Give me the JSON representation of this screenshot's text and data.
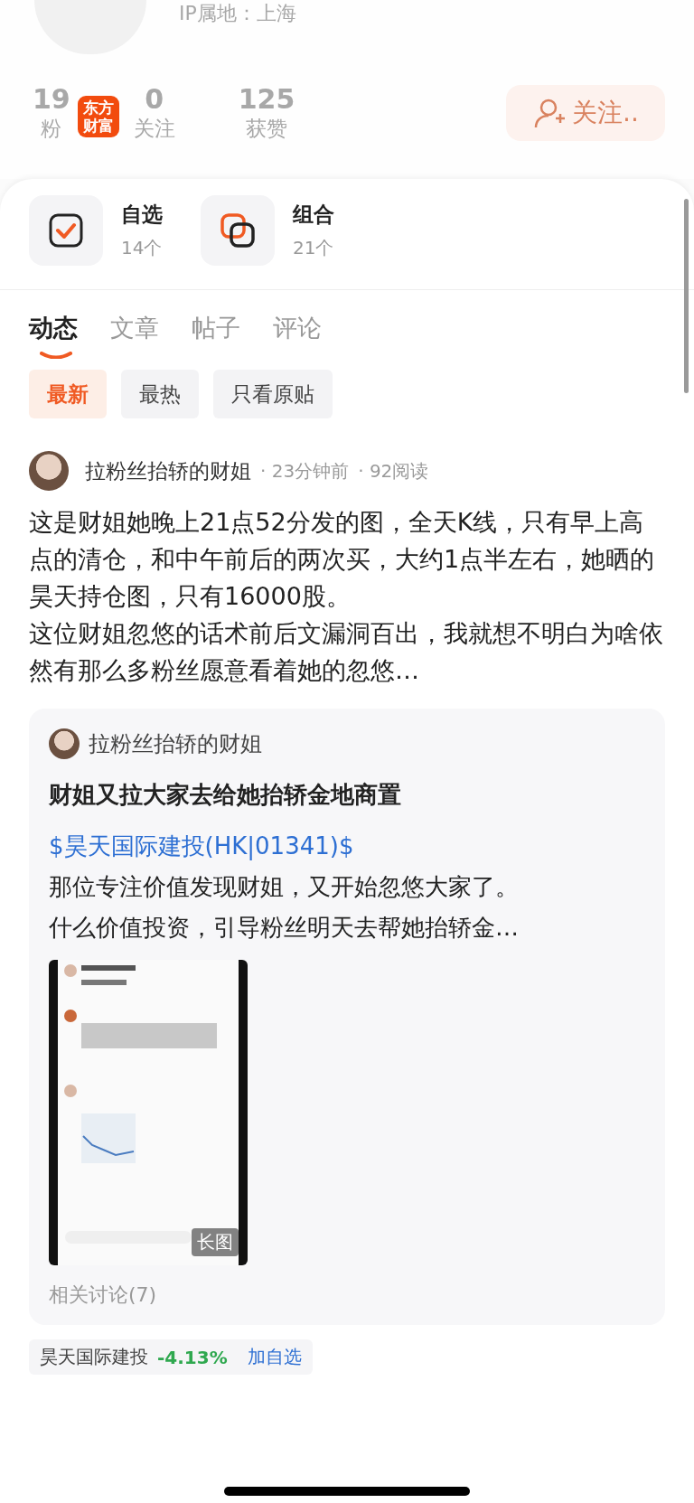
{
  "profile": {
    "ip_location": "IP属地：上海",
    "stats": [
      {
        "value": "19",
        "label": "粉"
      },
      {
        "value": "0",
        "label": "关注"
      },
      {
        "value": "125",
        "label": "获赞"
      }
    ],
    "follow_button": "关注..",
    "app_logo": "东方财富"
  },
  "shortcuts": [
    {
      "kind": "watchlist",
      "title": "自选",
      "count": "14个"
    },
    {
      "kind": "portfolio",
      "title": "组合",
      "count": "21个"
    }
  ],
  "tabs": [
    {
      "label": "动态",
      "selected": true
    },
    {
      "label": "文章",
      "selected": false
    },
    {
      "label": "帖子",
      "selected": false
    },
    {
      "label": "评论",
      "selected": false
    }
  ],
  "filters": [
    {
      "label": "最新",
      "selected": true
    },
    {
      "label": "最热",
      "selected": false
    },
    {
      "label": "只看原贴",
      "selected": false
    }
  ],
  "post": {
    "author": "拉粉丝抬轿的财姐",
    "time": "· 23分钟前",
    "reads": "· 92阅读",
    "paragraphs": [
      "这是财姐她晚上21点52分发的图，全天K线，只有早上高点的清仓，和中午前后的两次买，大约1点半左右，她晒的昊天持仓图，只有16000股。",
      "这位财姐忽悠的话术前后文漏洞百出，我就想不明白为啥依然有那么多粉丝愿意看着她的忽悠…"
    ],
    "quote": {
      "author": "拉粉丝抬轿的财姐",
      "title": "财姐又拉大家去给她抬轿金地商置",
      "stock_link": "$昊天国际建投(HK|01341)$",
      "lines": [
        "那位专注价值发现财姐，又开始忽悠大家了。",
        "什么价值投资，引导粉丝明天去帮她抬轿金…"
      ],
      "image": {
        "kind": "picture",
        "badge": "长图"
      },
      "related": "相关讨论(7)"
    },
    "stock": {
      "name": "昊天国际建投",
      "change": "-4.13%",
      "action": "加自选"
    }
  }
}
